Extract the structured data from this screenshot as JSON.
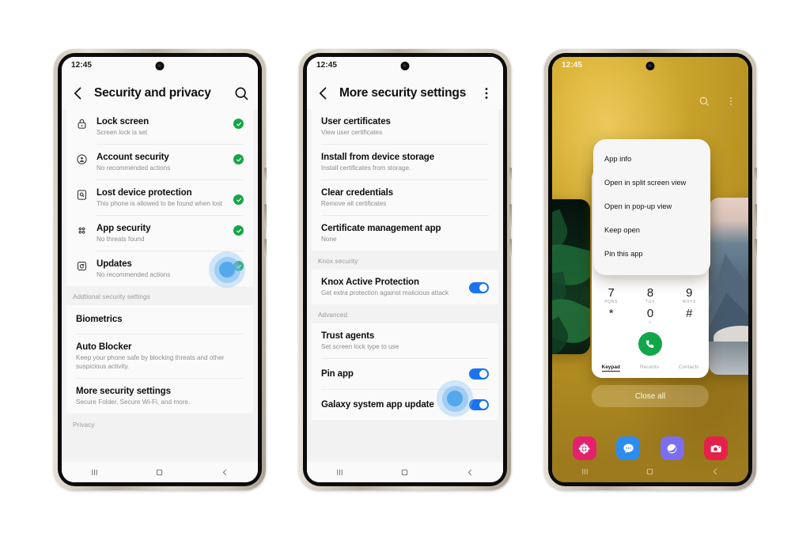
{
  "phones": [
    {
      "id": "phone-security-privacy",
      "status": {
        "clock": "12:45"
      },
      "appbar": {
        "back": "back-icon",
        "title": "Security and privacy",
        "action": "search-icon"
      },
      "groups": [
        {
          "label": null,
          "rows": [
            {
              "icon": "lock-icon",
              "title": "Lock screen",
              "subtitle": "Screen lock is set",
              "status": "check"
            },
            {
              "icon": "account-icon",
              "title": "Account security",
              "subtitle": "No recommended actions",
              "status": "check"
            },
            {
              "icon": "lost-device-icon",
              "title": "Lost device protection",
              "subtitle": "This phone is allowed to be found when lost",
              "status": "check"
            },
            {
              "icon": "app-security-icon",
              "title": "App security",
              "subtitle": "No threats found",
              "status": "check"
            },
            {
              "icon": "updates-icon",
              "title": "Updates",
              "subtitle": "No recommended actions",
              "status": "check"
            }
          ]
        },
        {
          "label": "Addtional security settings",
          "rows": [
            {
              "icon": null,
              "title": "Biometrics",
              "subtitle": null,
              "status": null
            },
            {
              "icon": null,
              "title": "Auto Blocker",
              "subtitle": "Keep your phone safe by blocking threats and other suspicious activity.",
              "status": null
            },
            {
              "icon": null,
              "title": "More security settings",
              "subtitle": "Secure Folder, Secure Wi-Fi, and more.",
              "status": null,
              "tap": true
            }
          ]
        },
        {
          "label": "Privacy",
          "rows": []
        }
      ],
      "nav": {
        "recents": "recents-icon",
        "home": "home-icon",
        "back": "back-nav-icon"
      }
    },
    {
      "id": "phone-more-security-settings",
      "status": {
        "clock": "12:45"
      },
      "appbar": {
        "back": "back-icon",
        "title": "More security settings",
        "action": "overflow-menu-icon"
      },
      "groups": [
        {
          "label": null,
          "rows": [
            {
              "title": "User certificates",
              "subtitle": "View user certificates"
            },
            {
              "title": "Install from device storage",
              "subtitle": "Install certificates from storage."
            },
            {
              "title": "Clear credentials",
              "subtitle": "Remove all certificates"
            },
            {
              "title": "Certificate management app",
              "subtitle": "None"
            }
          ]
        },
        {
          "label": "Knox security",
          "rows": [
            {
              "title": "Knox Active Protection",
              "subtitle": "Get extra protection against malicious attack",
              "toggle": "on"
            }
          ]
        },
        {
          "label": "Advanced",
          "rows": [
            {
              "title": "Trust agents",
              "subtitle": "Set screen lock type to use"
            },
            {
              "title": "Pin app",
              "subtitle": null,
              "toggle": "on",
              "tap": true
            },
            {
              "title": "Galaxy system app update",
              "subtitle": null,
              "toggle": "on"
            }
          ]
        }
      ],
      "nav": {
        "recents": "recents-icon",
        "home": "home-icon",
        "back": "back-nav-icon"
      }
    },
    {
      "id": "phone-recents",
      "status": {
        "clock": "12:45"
      },
      "top_actions": [
        "search-icon",
        "overflow-menu-icon"
      ],
      "context_menu": [
        "App info",
        "Open in split screen view",
        "Open in pop-up view",
        "Keep open",
        "Pin this app"
      ],
      "dialer": {
        "keys_row1": [
          {
            "num": "7",
            "sub": "PQRS"
          },
          {
            "num": "8",
            "sub": "TUV"
          },
          {
            "num": "9",
            "sub": "WXYZ"
          }
        ],
        "keys_row2": [
          {
            "num": "*",
            "sub": ""
          },
          {
            "num": "0",
            "sub": "+"
          },
          {
            "num": "#",
            "sub": ""
          }
        ],
        "call_button": "call-icon",
        "tabs": [
          "Keypad",
          "Recents",
          "Contacts"
        ],
        "active_tab": "Keypad"
      },
      "close_all": "Close all",
      "dock": [
        {
          "name": "gallery",
          "icon": "gallery-icon",
          "color": "#e5216d"
        },
        {
          "name": "messages",
          "icon": "messages-icon",
          "color": "#2d8cf0"
        },
        {
          "name": "internet",
          "icon": "internet-icon",
          "color": "#7b6ef0"
        },
        {
          "name": "camera",
          "icon": "camera-icon",
          "color": "#e5214a"
        }
      ],
      "nav": {
        "recents": "recents-icon",
        "home": "home-icon",
        "back": "back-nav-icon"
      }
    }
  ],
  "colors": {
    "accent_blue": "#1a73f0",
    "check_green": "#17a647",
    "wallpaper_gold": "#c9a42b",
    "ripple_blue": "#50a5eb"
  }
}
